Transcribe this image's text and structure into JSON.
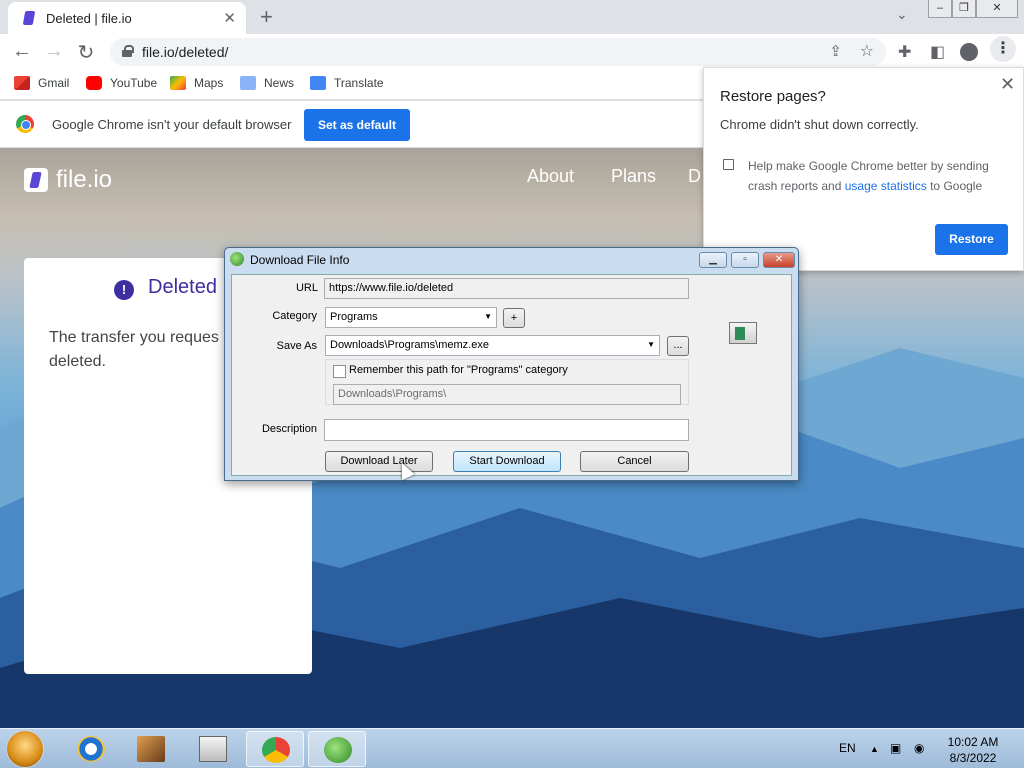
{
  "browser": {
    "tab_title": "Deleted | file.io",
    "tab_close": "✕",
    "new_tab": "+",
    "url": "file.io/deleted/",
    "bookmarks": [
      "Gmail",
      "YouTube",
      "Maps",
      "News",
      "Translate"
    ],
    "infobar_message": "Google Chrome isn't your default browser",
    "set_default_label": "Set as default"
  },
  "site": {
    "logo_text": "file.io",
    "nav": [
      "About",
      "Plans",
      "D"
    ],
    "card_heading": "Deleted",
    "card_body": "The transfer you reques been deleted."
  },
  "restore_popup": {
    "title": "Restore pages?",
    "subtitle": "Chrome didn't shut down correctly.",
    "help_text_before": "Help make Google Chrome better by sending crash reports and ",
    "help_link": "usage statistics",
    "help_text_after": " to Google",
    "restore_label": "Restore",
    "close": "✕"
  },
  "dialog": {
    "title": "Download File Info",
    "url_label": "URL",
    "url_value": "https://www.file.io/deleted",
    "category_label": "Category",
    "category_value": "Programs",
    "add_category": "+",
    "save_as_label": "Save As",
    "save_as_value": "Downloads\\Programs\\memz.exe",
    "browse": "...",
    "remember_label": "Remember this path for \"Programs\" category",
    "remember_path": "Downloads\\Programs\\",
    "description_label": "Description",
    "description_value": "",
    "download_later": "Download Later",
    "start_download": "Start Download",
    "cancel": "Cancel"
  },
  "taskbar": {
    "language": "EN",
    "time": "10:02 AM",
    "date": "8/3/2022"
  },
  "colors": {
    "chrome_blue": "#1a73e8",
    "fileio_purple": "#3d2fa0"
  }
}
